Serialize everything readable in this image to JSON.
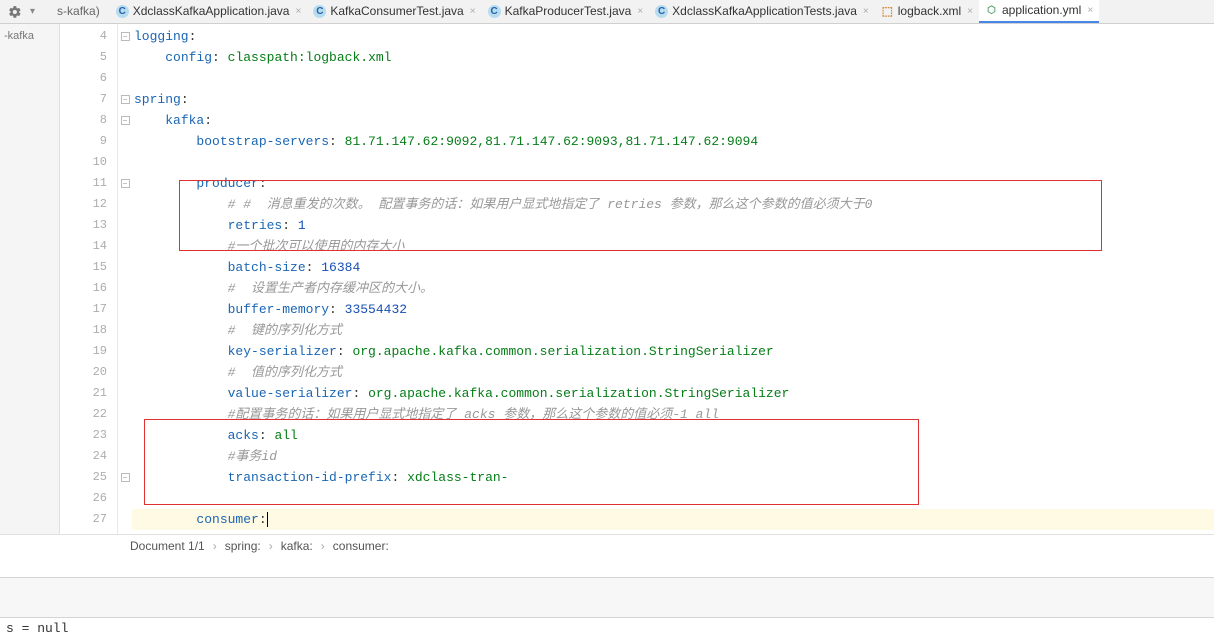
{
  "toolbar": {
    "project_fragment": "s-kafka)"
  },
  "sidebar": {
    "label": "-kafka"
  },
  "tabs": [
    {
      "icon": "java",
      "label": "XdclassKafkaApplication.java",
      "active": false
    },
    {
      "icon": "java",
      "label": "KafkaConsumerTest.java",
      "active": false
    },
    {
      "icon": "java",
      "label": "KafkaProducerTest.java",
      "active": false
    },
    {
      "icon": "java",
      "label": "XdclassKafkaApplicationTests.java",
      "active": false
    },
    {
      "icon": "xml",
      "label": "logback.xml",
      "active": false
    },
    {
      "icon": "yml",
      "label": "application.yml",
      "active": true
    }
  ],
  "lines": {
    "start": 4,
    "rows": [
      {
        "n": 4,
        "fold": "-",
        "indent": 0,
        "key": "logging",
        "colon": ":"
      },
      {
        "n": 5,
        "fold": "",
        "indent": 2,
        "key": "config",
        "colon": ": ",
        "val": "classpath:logback.xml"
      },
      {
        "n": 6,
        "fold": "",
        "indent": 0
      },
      {
        "n": 7,
        "fold": "-",
        "indent": 0,
        "key": "spring",
        "colon": ":"
      },
      {
        "n": 8,
        "fold": "-",
        "indent": 2,
        "key": "kafka",
        "colon": ":"
      },
      {
        "n": 9,
        "fold": "",
        "indent": 4,
        "key": "bootstrap-servers",
        "colon": ": ",
        "val": "81.71.147.62:9092,81.71.147.62:9093,81.71.147.62:9094"
      },
      {
        "n": 10,
        "fold": "",
        "indent": 0
      },
      {
        "n": 11,
        "fold": "-",
        "indent": 4,
        "key": "producer",
        "colon": ":"
      },
      {
        "n": 12,
        "fold": "",
        "indent": 6,
        "comment": "# #  消息重发的次数。 配置事务的话：如果用户显式地指定了 retries 参数，那么这个参数的值必须大于0"
      },
      {
        "n": 13,
        "fold": "",
        "indent": 6,
        "key": "retries",
        "colon": ": ",
        "num": "1"
      },
      {
        "n": 14,
        "fold": "",
        "indent": 6,
        "comment": "#一个批次可以使用的内存大小"
      },
      {
        "n": 15,
        "fold": "",
        "indent": 6,
        "key": "batch-size",
        "colon": ": ",
        "num": "16384"
      },
      {
        "n": 16,
        "fold": "",
        "indent": 6,
        "comment": "#  设置生产者内存缓冲区的大小。"
      },
      {
        "n": 17,
        "fold": "",
        "indent": 6,
        "key": "buffer-memory",
        "colon": ": ",
        "num": "33554432"
      },
      {
        "n": 18,
        "fold": "",
        "indent": 6,
        "comment": "#  键的序列化方式"
      },
      {
        "n": 19,
        "fold": "",
        "indent": 6,
        "key": "key-serializer",
        "colon": ": ",
        "val": "org.apache.kafka.common.serialization.StringSerializer"
      },
      {
        "n": 20,
        "fold": "",
        "indent": 6,
        "comment": "#  值的序列化方式"
      },
      {
        "n": 21,
        "fold": "",
        "indent": 6,
        "key": "value-serializer",
        "colon": ": ",
        "val": "org.apache.kafka.common.serialization.StringSerializer"
      },
      {
        "n": 22,
        "fold": "",
        "indent": 6,
        "comment": "#配置事务的话：如果用户显式地指定了 acks 参数，那么这个参数的值必须-1 all"
      },
      {
        "n": 23,
        "fold": "",
        "indent": 6,
        "key": "acks",
        "colon": ": ",
        "val": "all"
      },
      {
        "n": 24,
        "fold": "",
        "indent": 6,
        "comment": "#事务id"
      },
      {
        "n": 25,
        "fold": "-",
        "indent": 6,
        "key": "transaction-id-prefix",
        "colon": ": ",
        "val": "xdclass-tran-"
      },
      {
        "n": 26,
        "fold": "",
        "indent": 0
      },
      {
        "n": 27,
        "fold": "",
        "indent": 4,
        "key": "consumer",
        "colon": ":",
        "hl": true,
        "cursor": true
      }
    ]
  },
  "breadcrumb": {
    "doc": "Document 1/1",
    "path": [
      "spring:",
      "kafka:",
      "consumer:"
    ]
  },
  "console": {
    "text": "s = null"
  }
}
